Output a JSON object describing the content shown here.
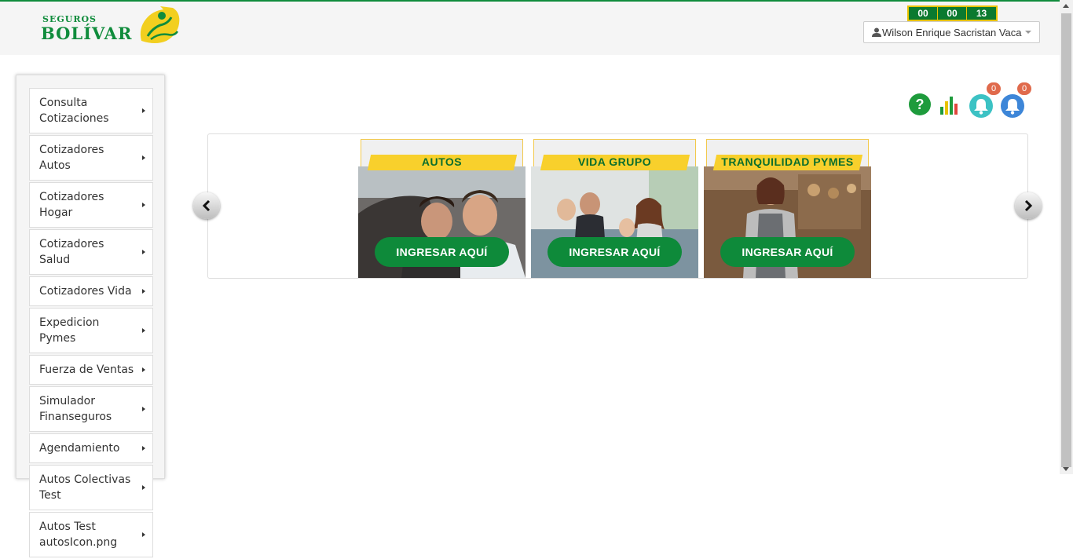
{
  "brand": {
    "small": "SEGUROS",
    "name": "BOLÍVAR"
  },
  "timer": {
    "hours": "00",
    "minutes": "00",
    "seconds": "13"
  },
  "user": {
    "name": "Wilson Enrique Sacristan Vaca"
  },
  "notifications": {
    "alerts_count": "0",
    "messages_count": "0"
  },
  "sidebar": {
    "items": [
      {
        "label": "Consulta Cotizaciones"
      },
      {
        "label": "Cotizadores Autos"
      },
      {
        "label": "Cotizadores Hogar"
      },
      {
        "label": "Cotizadores Salud"
      },
      {
        "label": "Cotizadores Vida"
      },
      {
        "label": "Expedicion Pymes"
      },
      {
        "label": "Fuerza de Ventas"
      },
      {
        "label": "Simulador Finanseguros"
      },
      {
        "label": "Agendamiento"
      },
      {
        "label": "Autos Colectivas Test"
      },
      {
        "label": "Autos Test autosIcon.png"
      }
    ]
  },
  "carousel": {
    "cards": [
      {
        "title": "AUTOS",
        "cta": "INGRESAR AQUÍ"
      },
      {
        "title": "VIDA GRUPO",
        "cta": "INGRESAR AQUÍ"
      },
      {
        "title": "TRANQUILIDAD PYMES",
        "cta": "INGRESAR AQUÍ"
      }
    ]
  },
  "colors": {
    "brand_green": "#108c3c",
    "brand_yellow": "#f8d02c",
    "badge": "#e06a4c"
  }
}
